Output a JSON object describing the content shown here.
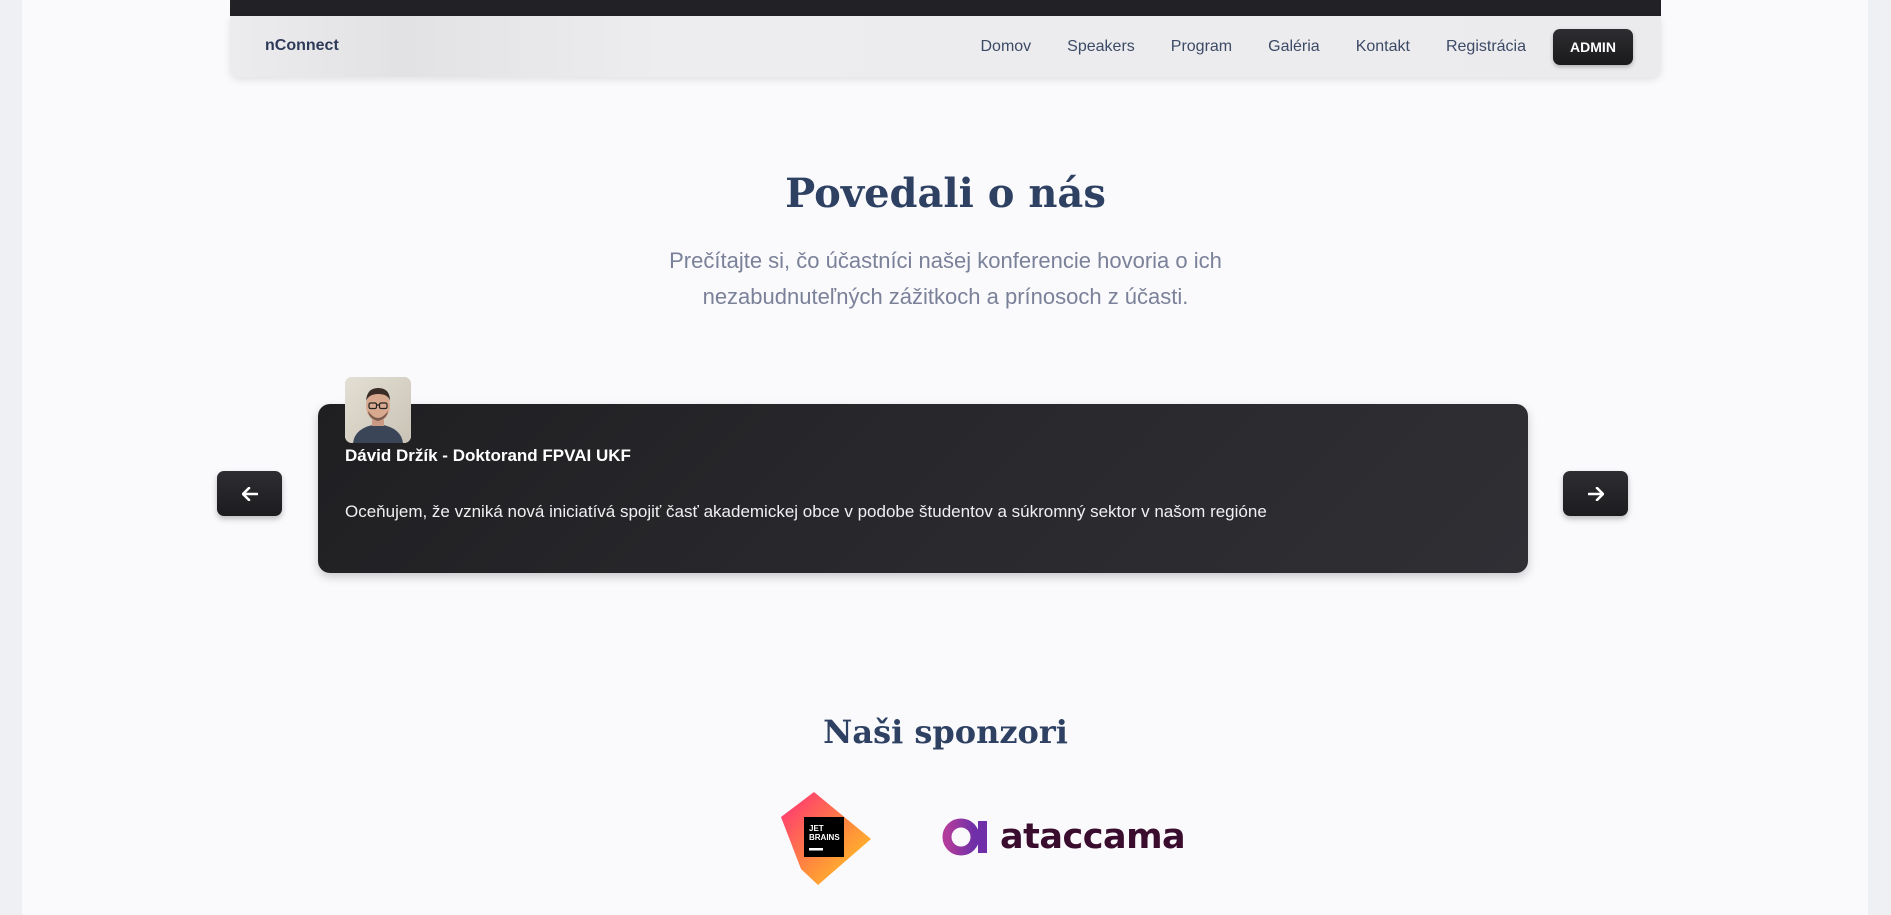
{
  "header": {
    "brand": "nConnect",
    "nav": [
      "Domov",
      "Speakers",
      "Program",
      "Galéria",
      "Kontakt",
      "Registrácia"
    ],
    "admin_label": "ADMIN"
  },
  "testimonials": {
    "title": "Povedali o nás",
    "subtitle_line1": "Prečítajte si, čo účastníci našej konferencie hovoria o ich",
    "subtitle_line2": "nezabudnuteľných zážitkoch a prínosoch z účasti.",
    "current": {
      "name": "Dávid Držík - Doktorand FPVAI UKF",
      "quote": "Oceňujem, že vzniká nová iniciatívá spojiť časť akademickej obce v podobe študentov a súkromný sektor v našom regióne"
    },
    "prev_icon": "arrow-left-icon",
    "next_icon": "arrow-right-icon"
  },
  "sponsors": {
    "title": "Naši sponzori",
    "items": [
      {
        "name": "JetBrains",
        "logo_text_line1": "JET",
        "logo_text_line2": "BRAINS"
      },
      {
        "name": "ataccama",
        "logo_text": "ataccama"
      }
    ]
  }
}
